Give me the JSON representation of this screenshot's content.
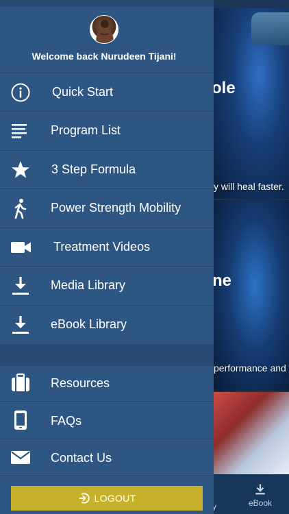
{
  "user": {
    "welcome": "Welcome back Nurudeen Tijani!"
  },
  "menu": {
    "primary": [
      {
        "label": "Quick Start",
        "icon": "info-icon"
      },
      {
        "label": "Program List",
        "icon": "list-icon"
      },
      {
        "label": "3 Step Formula",
        "icon": "star-icon"
      },
      {
        "label": "Power Strength Mobility",
        "icon": "walking-icon"
      },
      {
        "label": "Treatment Videos",
        "icon": "video-camera-icon"
      },
      {
        "label": "Media Library",
        "icon": "download-icon"
      },
      {
        "label": "eBook Library",
        "icon": "download-icon"
      }
    ],
    "secondary": [
      {
        "label": "Resources",
        "icon": "briefcase-icon"
      },
      {
        "label": "FAQs",
        "icon": "mobile-phone-icon"
      },
      {
        "label": "Contact Us",
        "icon": "envelope-icon"
      }
    ],
    "logout_label": "LOGOUT"
  },
  "background": {
    "card1": {
      "title_fragment": "ole",
      "text_fragment": "y will heal faster."
    },
    "card2": {
      "title_fragment": "ne",
      "text_fragment": "performance and"
    },
    "bottom_nav": {
      "partial_label": "y",
      "ebook_label": "eBook"
    }
  },
  "colors": {
    "drawer": "#2e5682",
    "logout_button": "#c7b12b"
  }
}
